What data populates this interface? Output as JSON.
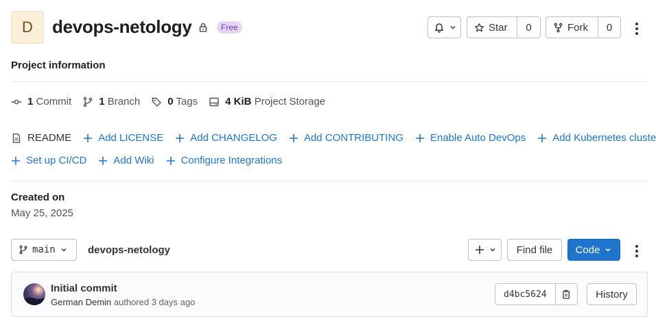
{
  "project": {
    "avatar_letter": "D",
    "name": "devops-netology",
    "visibility_icon": "lock-icon",
    "plan_badge": "Free"
  },
  "header_actions": {
    "notifications_icon": "bell-icon",
    "star_label": "Star",
    "star_count": "0",
    "fork_label": "Fork",
    "fork_count": "0"
  },
  "project_info": {
    "title": "Project information",
    "stats": [
      {
        "icon": "commit-icon",
        "count": "1",
        "label": "Commit"
      },
      {
        "icon": "branch-icon",
        "count": "1",
        "label": "Branch"
      },
      {
        "icon": "tag-icon",
        "count": "0",
        "label": "Tags"
      },
      {
        "icon": "disk-icon",
        "count": "4 KiB",
        "label": "Project Storage"
      }
    ],
    "links_row1": [
      {
        "icon": "doc-icon",
        "label": "README"
      },
      {
        "icon": "plus-icon",
        "label": "Add LICENSE"
      },
      {
        "icon": "plus-icon",
        "label": "Add CHANGELOG"
      },
      {
        "icon": "plus-icon",
        "label": "Add CONTRIBUTING"
      },
      {
        "icon": "plus-icon",
        "label": "Enable Auto DevOps"
      },
      {
        "icon": "plus-icon",
        "label": "Add Kubernetes cluster"
      }
    ],
    "links_row2": [
      {
        "icon": "plus-icon",
        "label": "Set up CI/CD"
      },
      {
        "icon": "plus-icon",
        "label": "Add Wiki"
      },
      {
        "icon": "plus-icon",
        "label": "Configure Integrations"
      }
    ],
    "created_label": "Created on",
    "created_date": "May 25, 2025"
  },
  "repo": {
    "branch": "main",
    "path": "devops-netology",
    "find_file_label": "Find file",
    "code_label": "Code"
  },
  "last_commit": {
    "title": "Initial commit",
    "author": "German Demin",
    "meta_suffix": "authored 3 days ago",
    "sha": "d4bc5624",
    "history_label": "History"
  },
  "colors": {
    "link": "#1f75cb",
    "primary_button": "#1f75cb",
    "badge_bg": "#e4d6f7",
    "badge_text": "#6f3ab8"
  }
}
